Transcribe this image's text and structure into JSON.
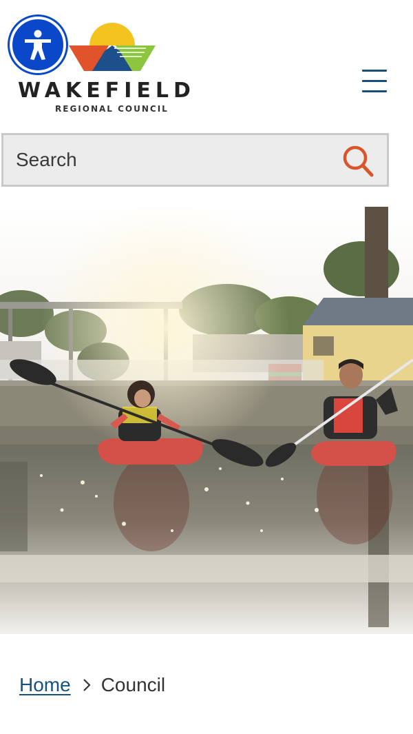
{
  "header": {
    "accessibility_icon": "accessibility-person-icon",
    "logo": {
      "wordmark": "WAKEFIELD",
      "subtitle": "REGIONAL COUNCIL",
      "colors": {
        "sun": "#f3c41f",
        "left_field": "#e0532b",
        "right_field": "#8cc63f",
        "hill": "#1d4f8a"
      }
    },
    "menu_icon": "hamburger-menu-icon"
  },
  "search": {
    "placeholder": "Search",
    "icon": "search-icon",
    "icon_color": "#d9562b"
  },
  "hero": {
    "image_alt": "Two children kayaking on calm water at sunset",
    "description": "photo"
  },
  "breadcrumb": {
    "home_label": "Home",
    "separator_icon": "chevron-right-icon",
    "current_label": "Council"
  },
  "colors": {
    "accent": "#1b4d7a",
    "accessibility_blue": "#0a48c9"
  }
}
